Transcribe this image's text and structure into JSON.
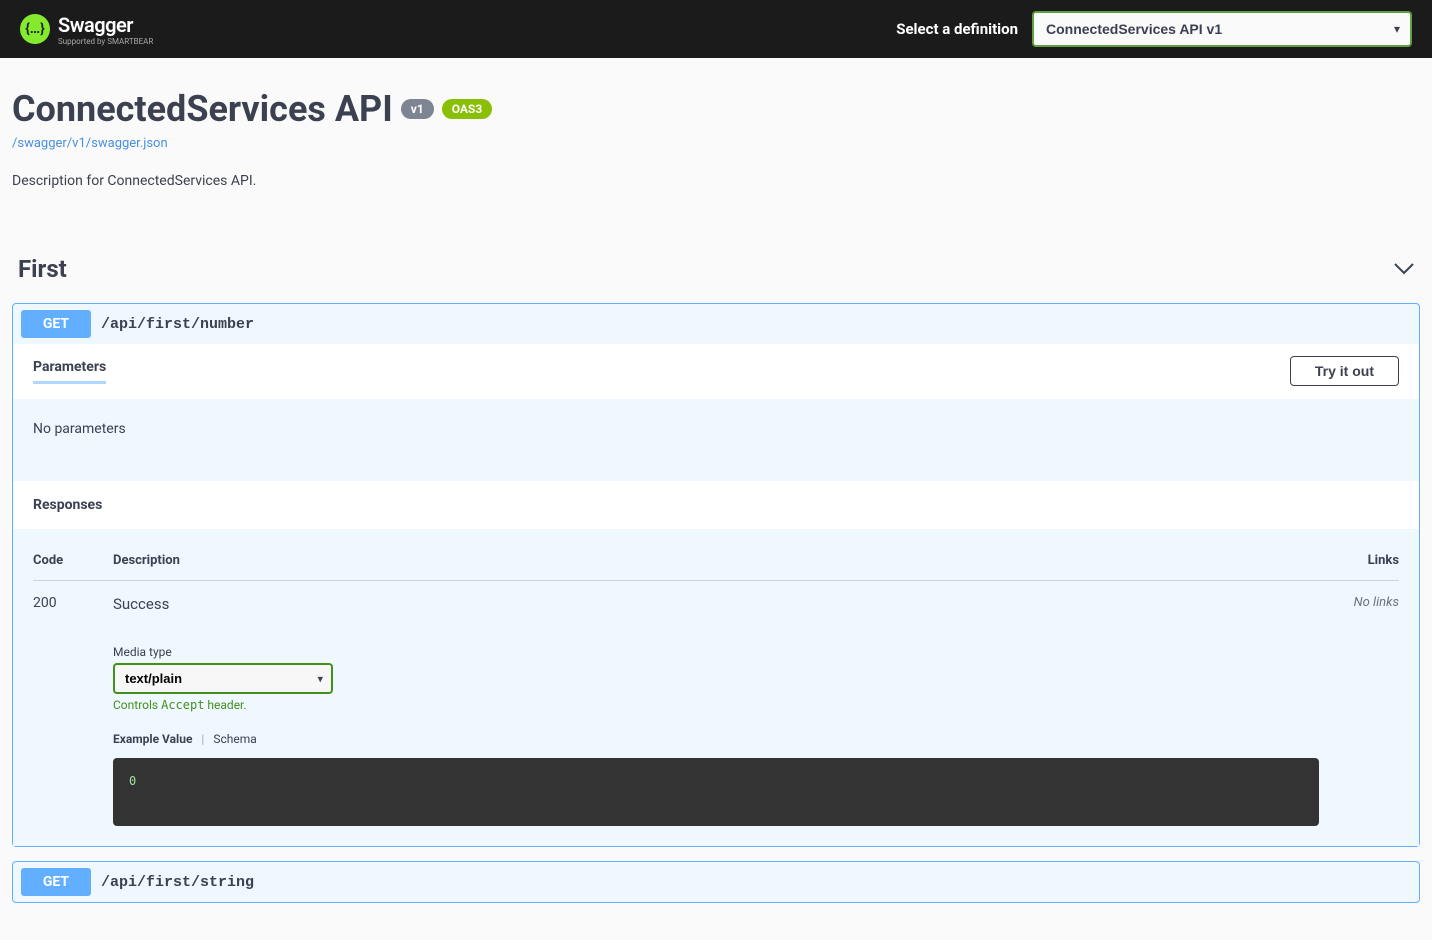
{
  "topbar": {
    "logo_main": "Swagger",
    "logo_sub": "Supported by SMARTBEAR",
    "select_label": "Select a definition",
    "definition_selected": "ConnectedServices API v1"
  },
  "api": {
    "title": "ConnectedServices API",
    "version_badge": "v1",
    "oas_badge": "OAS3",
    "spec_url": "/swagger/v1/swagger.json",
    "description": "Description for ConnectedServices API."
  },
  "tag": {
    "name": "First"
  },
  "op1": {
    "method": "GET",
    "path": "/api/first/number",
    "parameters_title": "Parameters",
    "try_it_out": "Try it out",
    "no_parameters": "No parameters",
    "responses_title": "Responses",
    "col_code": "Code",
    "col_desc": "Description",
    "col_links": "Links",
    "response_code": "200",
    "response_desc": "Success",
    "no_links": "No links",
    "media_type_label": "Media type",
    "media_type_value": "text/plain",
    "controls_pre": "Controls ",
    "controls_mono": "Accept",
    "controls_post": " header.",
    "example_label": "Example Value",
    "schema_label": "Schema",
    "example_value": "0"
  },
  "op2": {
    "method": "GET",
    "path": "/api/first/string"
  }
}
